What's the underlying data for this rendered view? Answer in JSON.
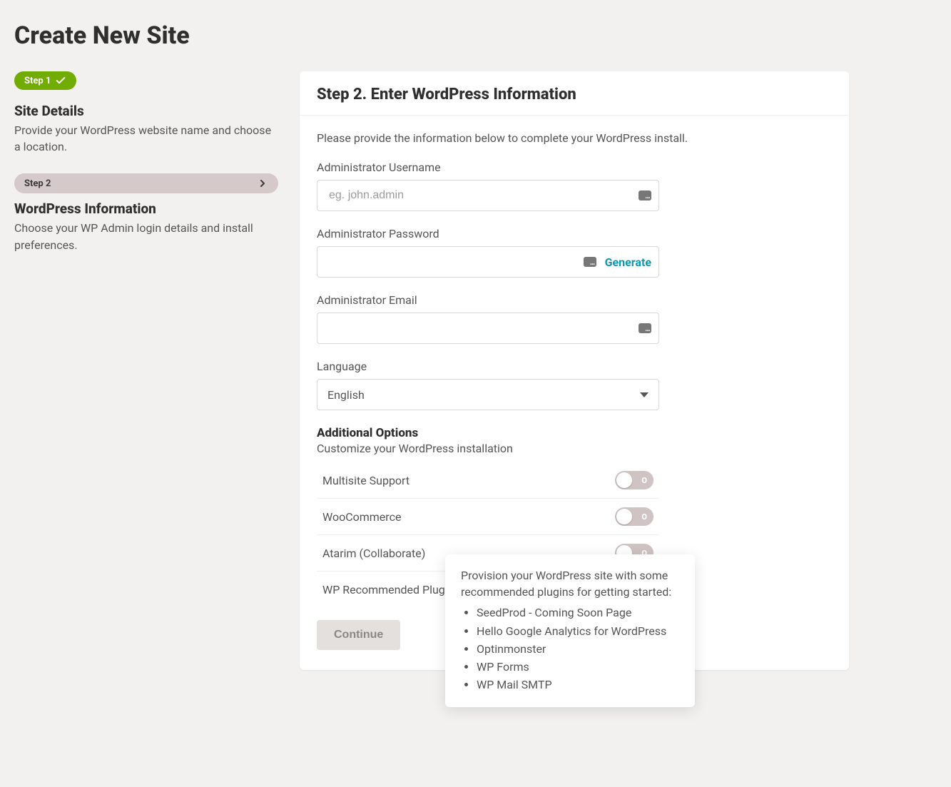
{
  "page_title": "Create New Site",
  "sidebar": {
    "step1": {
      "pill": "Step 1",
      "title": "Site Details",
      "desc": "Provide your WordPress website name and choose a location."
    },
    "step2": {
      "pill": "Step 2",
      "title": "WordPress Information",
      "desc": "Choose your WP Admin login details and install preferences."
    }
  },
  "card": {
    "heading": "Step 2. Enter WordPress Information",
    "intro": "Please provide the information below to complete your WordPress install.",
    "fields": {
      "username_label": "Administrator Username",
      "username_placeholder": "eg. john.admin",
      "password_label": "Administrator Password",
      "generate": "Generate",
      "email_label": "Administrator Email",
      "language_label": "Language",
      "language_value": "English"
    },
    "options": {
      "heading": "Additional Options",
      "sub": "Customize your WordPress installation",
      "rows": [
        {
          "label": "Multisite Support",
          "on": false
        },
        {
          "label": "WooCommerce",
          "on": false
        },
        {
          "label": "Atarim (Collaborate)",
          "on": false
        },
        {
          "label": "WP Recommended Plugins",
          "on": true,
          "help": true
        }
      ]
    },
    "continue": "Continue"
  },
  "tooltip": {
    "intro": "Provision your WordPress site with some recommended plugins for getting started:",
    "items": [
      "SeedProd - Coming Soon Page",
      "Hello Google Analytics for WordPress",
      "Optinmonster",
      "WP Forms",
      "WP Mail SMTP"
    ]
  }
}
